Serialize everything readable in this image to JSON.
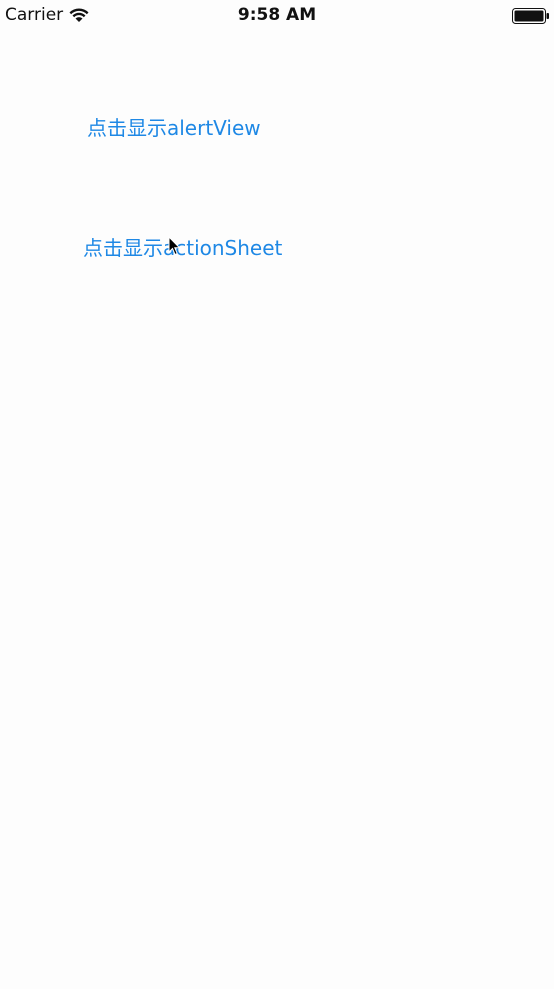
{
  "status_bar": {
    "carrier": "Carrier",
    "time": "9:58 AM",
    "wifi_icon": "wifi-icon",
    "battery_icon": "battery-icon"
  },
  "buttons": {
    "alert_label": "点击显示alertView",
    "action_sheet_label": "点击显示actionSheet"
  },
  "colors": {
    "accent": "#1e88e5",
    "background": "#fdfdfd",
    "status_text": "#111111"
  },
  "cursor": {
    "icon": "mouse-pointer-icon"
  }
}
